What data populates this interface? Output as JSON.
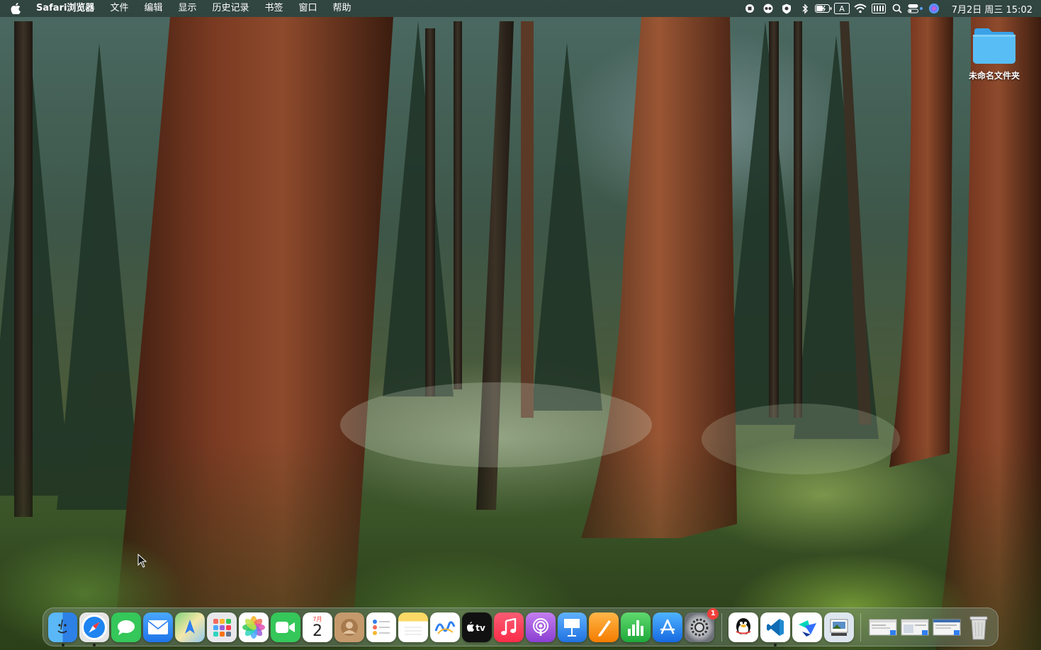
{
  "menubar": {
    "app_name": "Safari浏览器",
    "items": [
      "文件",
      "编辑",
      "显示",
      "历史记录",
      "书签",
      "窗口",
      "帮助"
    ],
    "status_icons": [
      "record-icon",
      "glasses-icon",
      "shield-icon",
      "bluetooth-icon",
      "battery-icon",
      "input-method-icon",
      "wifi-icon",
      "keyboard-icon",
      "search-icon",
      "control-center-icon",
      "siri-icon"
    ],
    "input_method_label": "A",
    "clock": "7月2日 周三  15:02"
  },
  "desktop": {
    "folder_label": "未命名文件夹"
  },
  "dock": {
    "apps": [
      {
        "name": "finder",
        "color": "#2f8ef2",
        "glyph": "☺",
        "running": true
      },
      {
        "name": "safari",
        "color": "#1d7ff0",
        "glyph": "⊘",
        "running": true
      },
      {
        "name": "messages",
        "color": "#35c759",
        "glyph": "💬",
        "running": false
      },
      {
        "name": "mail",
        "color": "#2f8ef2",
        "glyph": "✉",
        "running": false
      },
      {
        "name": "maps",
        "color": "#6cc26a",
        "glyph": "➤",
        "running": false
      },
      {
        "name": "launchpad",
        "color": "#e7e7ea",
        "glyph": "▦",
        "running": false
      },
      {
        "name": "photos",
        "color": "#ffffff",
        "glyph": "✿",
        "running": false
      },
      {
        "name": "facetime",
        "color": "#35c759",
        "glyph": "▶",
        "running": false
      },
      {
        "name": "calendar",
        "color": "#ffffff",
        "glyph": "",
        "running": false
      },
      {
        "name": "contacts",
        "color": "#b98a5e",
        "glyph": "☻",
        "running": false
      },
      {
        "name": "reminders",
        "color": "#ffffff",
        "glyph": "☰",
        "running": false
      },
      {
        "name": "notes",
        "color": "#fbe28a",
        "glyph": "≡",
        "running": false
      },
      {
        "name": "freeform",
        "color": "#ffffff",
        "glyph": "∿",
        "running": false
      },
      {
        "name": "apple-tv",
        "color": "#111111",
        "glyph": "tv",
        "running": false
      },
      {
        "name": "music",
        "color": "#fa3c50",
        "glyph": "♫",
        "running": false
      },
      {
        "name": "podcasts",
        "color": "#9b5cd6",
        "glyph": "◎",
        "running": false
      },
      {
        "name": "keynote",
        "color": "#2f8ef2",
        "glyph": "▥",
        "running": false
      },
      {
        "name": "pages",
        "color": "#f5a623",
        "glyph": "✎",
        "running": false
      },
      {
        "name": "numbers",
        "color": "#35c759",
        "glyph": "▮",
        "running": false
      },
      {
        "name": "app-store",
        "color": "#1d7ff0",
        "glyph": "A",
        "running": false
      },
      {
        "name": "system-settings",
        "color": "#8e8e93",
        "glyph": "⚙",
        "running": false,
        "badge": "1"
      }
    ],
    "calendar": {
      "month": "7月",
      "day": "2"
    },
    "apps2": [
      {
        "name": "qq",
        "color": "#ffffff",
        "glyph": "🐧",
        "running": false
      },
      {
        "name": "vscode",
        "color": "#ffffff",
        "glyph": "≺",
        "running": true
      },
      {
        "name": "feishu",
        "color": "#ffffff",
        "glyph": "✈",
        "running": false
      },
      {
        "name": "preview",
        "color": "#dde6ee",
        "glyph": "▣",
        "running": false
      }
    ],
    "docs": [
      "minimized-window-1",
      "minimized-window-2",
      "minimized-window-3"
    ],
    "trash": "trash-icon"
  }
}
